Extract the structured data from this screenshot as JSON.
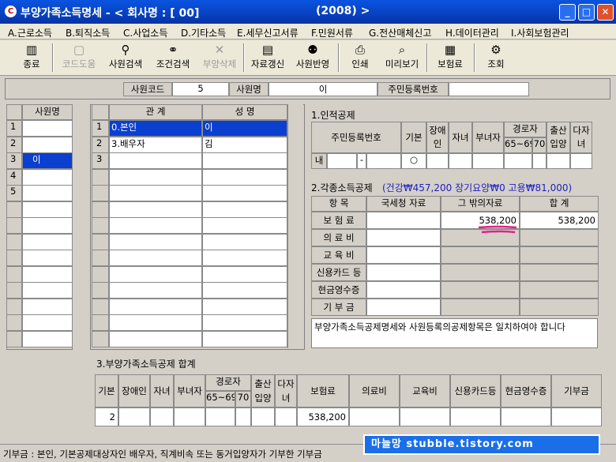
{
  "window": {
    "title": "부양가족소득명세 - < 회사명 : [ 00]",
    "year": "(2008) >"
  },
  "menu": [
    "A.근로소득",
    "B.퇴직소득",
    "C.사업소득",
    "D.기타소득",
    "E.세무신고서류",
    "F.민원서류",
    "G.전산매체신고",
    "H.데이터관리",
    "I.사회보험관리"
  ],
  "toolbar": [
    {
      "label": "종료",
      "icon": "exit-icon",
      "glyph": "▥",
      "enabled": true
    },
    {
      "label": "코드도움",
      "icon": "code-help-icon",
      "glyph": "▢",
      "enabled": false
    },
    {
      "label": "사원검색",
      "icon": "employee-search-icon",
      "glyph": "⚲",
      "enabled": true
    },
    {
      "label": "조건검색",
      "icon": "binoculars-icon",
      "glyph": "⚭",
      "enabled": true
    },
    {
      "label": "부양삭제",
      "icon": "delete-icon",
      "glyph": "✕",
      "enabled": false
    },
    {
      "label": "자료갱신",
      "icon": "refresh-data-icon",
      "glyph": "▤",
      "enabled": true
    },
    {
      "label": "사원반영",
      "icon": "apply-employee-icon",
      "glyph": "⚉",
      "enabled": true
    },
    {
      "label": "인쇄",
      "icon": "printer-icon",
      "glyph": "⎙",
      "enabled": true
    },
    {
      "label": "미리보기",
      "icon": "preview-icon",
      "glyph": "⌕",
      "enabled": true
    },
    {
      "label": "보험료",
      "icon": "insurance-icon",
      "glyph": "▦",
      "enabled": true
    },
    {
      "label": "조회",
      "icon": "lookup-icon",
      "glyph": "⚙",
      "enabled": true
    }
  ],
  "employee": {
    "code_label": "사원코드",
    "code": "5",
    "name_label": "사원명",
    "name": "이",
    "rrn_label": "주민등록번호",
    "rrn": ""
  },
  "emp_list": {
    "header": "사원명",
    "rows": [
      {
        "no": "1",
        "name": ""
      },
      {
        "no": "2",
        "name": ""
      },
      {
        "no": "3",
        "name": "이"
      },
      {
        "no": "4",
        "name": ""
      },
      {
        "no": "5",
        "name": ""
      }
    ],
    "selected_row": 3
  },
  "dependents": {
    "col_relation": "관  계",
    "col_name": "성  명",
    "rows": [
      {
        "no": "1",
        "relation": "0.본인",
        "name": "이"
      },
      {
        "no": "2",
        "relation": "3.배우자",
        "name": "김"
      },
      {
        "no": "3",
        "relation": "",
        "name": ""
      }
    ],
    "selected_row": 1
  },
  "personal": {
    "title": "1.인적공제",
    "h_rrn": "주민등록번호",
    "h_basic": "기본",
    "h_disabled": "장애인",
    "h_child": "자녀",
    "h_woman": "부녀자",
    "h_elder": "경로자",
    "h_6569": "65~69",
    "h_70": "70",
    "h_birth": "출산입양",
    "h_multi": "다자녀",
    "row": {
      "type": "내",
      "rrn_sep": "-",
      "basic": "○"
    }
  },
  "deduct": {
    "title": "2.각종소득공제",
    "summary": "(건강₩457,200 장기요양₩0 고용₩81,000)",
    "h_item": "항  목",
    "h_nts": "국세청 자료",
    "h_other": "그 밖의자료",
    "h_total": "합  계",
    "rows": [
      {
        "item": "보 험 료",
        "nts": "",
        "other": "538,200",
        "total": "538,200"
      },
      {
        "item": "의 료 비",
        "nts": "",
        "other": "",
        "total": ""
      },
      {
        "item": "교 육 비",
        "nts": "",
        "other": "",
        "total": ""
      },
      {
        "item": "신용카드 등",
        "nts": "",
        "other": "",
        "total": ""
      },
      {
        "item": "현금영수증",
        "nts": "",
        "other": "",
        "total": ""
      },
      {
        "item": "기 부 금",
        "nts": "",
        "other": "",
        "total": ""
      }
    ],
    "note": "부양가족소득공제명세와 사원등록의공제항목은 일치하여야 합니다"
  },
  "summary": {
    "title": "3.부양가족소득공제 합계",
    "h_basic": "기본",
    "h_disabled": "장애인",
    "h_child": "자녀",
    "h_woman": "부녀자",
    "h_elder": "경로자",
    "h_6569": "65~69",
    "h_70": "70",
    "h_birth": "출산입양",
    "h_multi": "다자녀",
    "h_ins": "보험료",
    "h_med": "의료비",
    "h_edu": "교육비",
    "h_card": "신용카드등",
    "h_cash": "현금영수증",
    "h_donation": "기부금",
    "row": {
      "basic": "2",
      "ins": "538,200"
    }
  },
  "status": {
    "text": "기부금 : 본인, 기본공제대상자인 배우자, 직계비속 또는 동거입양자가 기부한 기부금",
    "watermark": "마늘망  stubble.tistory.com"
  },
  "colors": {
    "title": "#0841c0",
    "selection": "#0a3fd0",
    "annotation": "#e0208a",
    "watermark_bg": "#1a6fe8"
  }
}
